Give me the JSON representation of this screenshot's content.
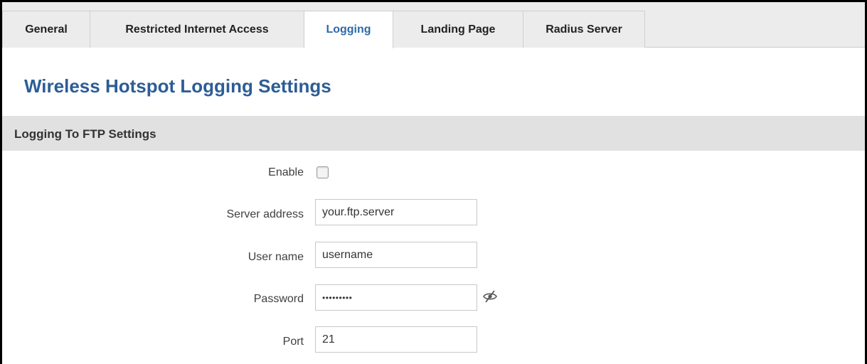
{
  "tabs": [
    {
      "label": "General",
      "active": false
    },
    {
      "label": "Restricted Internet Access",
      "active": false
    },
    {
      "label": "Logging",
      "active": true
    },
    {
      "label": "Landing Page",
      "active": false
    },
    {
      "label": "Radius Server",
      "active": false
    }
  ],
  "page": {
    "title": "Wireless Hotspot Logging Settings"
  },
  "section": {
    "title": "Logging To FTP Settings"
  },
  "form": {
    "enable": {
      "label": "Enable",
      "checked": false
    },
    "server_address": {
      "label": "Server address",
      "value": "your.ftp.server"
    },
    "user_name": {
      "label": "User name",
      "value": "username"
    },
    "password": {
      "label": "Password",
      "value": "•••••••••",
      "icon": "eye-slash-icon"
    },
    "port": {
      "label": "Port",
      "value": "21"
    }
  },
  "colors": {
    "active_tab_text": "#2e6aa6",
    "title": "#2c5d95",
    "section_bar": "#e1e1e1",
    "tab_bar": "#ececec"
  }
}
